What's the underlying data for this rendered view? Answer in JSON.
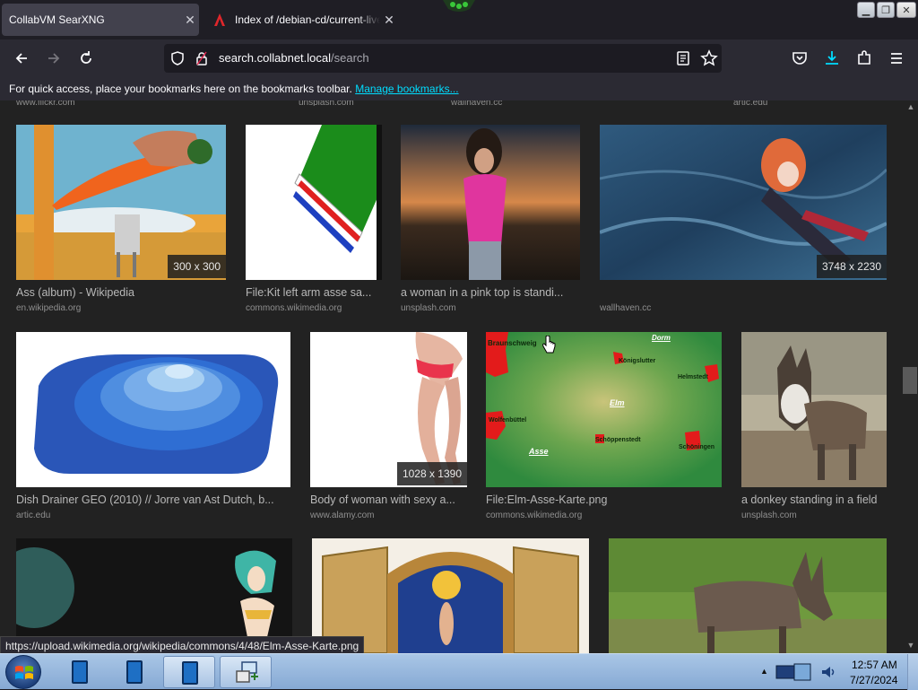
{
  "tabs": [
    {
      "title": "CollabVM SearXNG",
      "active": true
    },
    {
      "title": "Index of /debian-cd/current-live",
      "active": false
    }
  ],
  "navbar": {
    "url_host": "search.collabnet.local",
    "url_path": "/search"
  },
  "bookmarks_bar": {
    "message": "For quick access, place your bookmarks here on the bookmarks toolbar.",
    "link": "Manage bookmarks..."
  },
  "prev_row_domains": [
    "www.flickr.com",
    "unsplash.com",
    "wallhaven.cc",
    "artic.edu"
  ],
  "results": [
    {
      "title": "Ass (album) - Wikipedia",
      "domain": "en.wikipedia.org",
      "dimensions": "300 x 300"
    },
    {
      "title": "File:Kit left arm asse sa...",
      "domain": "commons.wikimedia.org",
      "dimensions": ""
    },
    {
      "title": "a woman in a pink top is standi...",
      "domain": "unsplash.com",
      "dimensions": ""
    },
    {
      "title": "",
      "domain": "wallhaven.cc",
      "dimensions": "3748 x 2230"
    },
    {
      "title": "Dish Drainer GEO (2010) // Jorre van Ast Dutch, b...",
      "domain": "artic.edu",
      "dimensions": ""
    },
    {
      "title": "Body of woman with sexy a...",
      "domain": "www.alamy.com",
      "dimensions": "1028 x 1390"
    },
    {
      "title": "File:Elm-Asse-Karte.png",
      "domain": "commons.wikimedia.org",
      "dimensions": ""
    },
    {
      "title": "a donkey standing in a field",
      "domain": "unsplash.com",
      "dimensions": ""
    },
    {
      "title": "",
      "domain": "",
      "dimensions": ""
    },
    {
      "title": "",
      "domain": "",
      "dimensions": ""
    },
    {
      "title": "",
      "domain": "",
      "dimensions": ""
    }
  ],
  "map_labels": [
    "Braunschweig",
    "Dorm",
    "Königslutter",
    "Helmstedt",
    "Elm",
    "Wolfenbüttel",
    "Schöppenstedt",
    "Schöningen",
    "Asse"
  ],
  "status_url": "https://upload.wikimedia.org/wikipedia/commons/4/48/Elm-Asse-Karte.png",
  "clock": {
    "time": "12:57 AM",
    "date": "7/27/2024"
  },
  "icons": {
    "back": "back-arrow-icon",
    "forward": "forward-arrow-icon",
    "reload": "reload-icon",
    "shield": "shield-icon",
    "lock": "lock-icon",
    "reader": "reader-view-icon",
    "star": "bookmark-star-icon",
    "pocket": "pocket-icon",
    "downloads": "download-icon",
    "extensions": "extensions-icon",
    "menu": "hamburger-menu-icon"
  },
  "colors": {
    "accent_link": "#00ddff",
    "download_icon": "#00ddff",
    "content_bg": "#222222"
  }
}
